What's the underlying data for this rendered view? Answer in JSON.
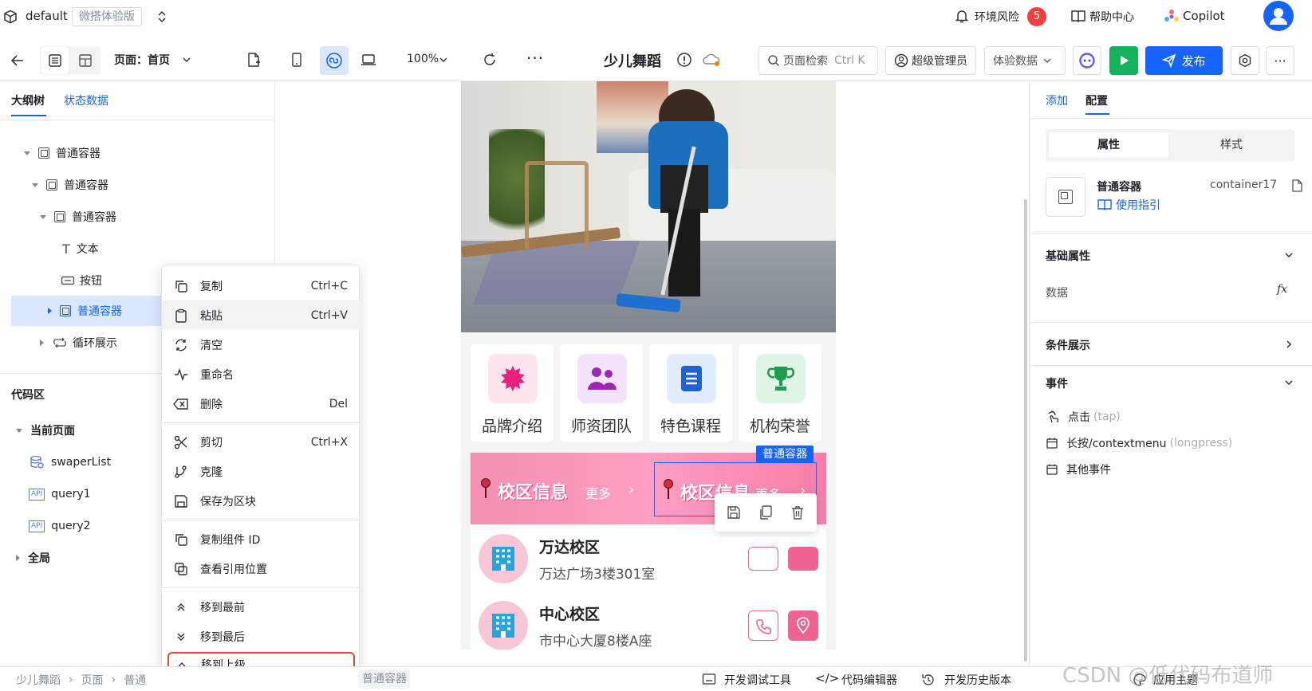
{
  "topbar": {
    "app_name": "default",
    "edition_badge": "微搭体验版",
    "env_risk_label": "环境风险",
    "env_risk_count": "5",
    "help_label": "帮助中心",
    "copilot_label": "Copilot"
  },
  "toolbar": {
    "page_label": "页面：首页",
    "zoom": "100%",
    "app_title": "少儿舞蹈",
    "search_label": "页面检索",
    "search_shortcut": "Ctrl K",
    "admin_label": "超级管理员",
    "data_mode": "体验数据",
    "publish_label": "发布"
  },
  "left": {
    "tab_outline": "大纲树",
    "tab_state": "状态数据",
    "tree": [
      {
        "label": "普通容器"
      },
      {
        "label": "普通容器"
      },
      {
        "label": "普通容器"
      },
      {
        "label": "文本"
      },
      {
        "label": "按钮"
      },
      {
        "label": "普通容器"
      },
      {
        "label": "循环展示"
      }
    ],
    "code_title": "代码区",
    "current_page": "当前页面",
    "code_items": [
      "swaperList",
      "query1",
      "query2"
    ],
    "global_label": "全局",
    "api_tag": "API"
  },
  "menu": {
    "items": [
      {
        "label": "复制",
        "shortcut": "Ctrl+C"
      },
      {
        "label": "粘贴",
        "shortcut": "Ctrl+V"
      },
      {
        "label": "清空",
        "shortcut": ""
      },
      {
        "label": "重命名",
        "shortcut": ""
      },
      {
        "label": "删除",
        "shortcut": "Del"
      },
      {
        "label": "剪切",
        "shortcut": "Ctrl+X"
      },
      {
        "label": "克隆",
        "shortcut": ""
      },
      {
        "label": "保存为区块",
        "shortcut": ""
      },
      {
        "label": "复制组件 ID",
        "shortcut": ""
      },
      {
        "label": "查看引用位置",
        "shortcut": ""
      },
      {
        "label": "移到最前",
        "shortcut": ""
      },
      {
        "label": "移到最后",
        "shortcut": ""
      },
      {
        "label": "移到上级",
        "shortcut": ""
      }
    ]
  },
  "canvas": {
    "cards": [
      {
        "label": "品牌介绍"
      },
      {
        "label": "师资团队"
      },
      {
        "label": "特色课程"
      },
      {
        "label": "机构荣誉"
      }
    ],
    "section_title": "校区信息",
    "more_label": "更多",
    "selected_tag": "普通容器",
    "campuses": [
      {
        "name": "万达校区",
        "address": "万达广场3楼301室"
      },
      {
        "name": "中心校区",
        "address": "市中心大厦8楼A座"
      }
    ]
  },
  "right": {
    "tab_add": "添加",
    "tab_config": "配置",
    "seg_props": "属性",
    "seg_style": "样式",
    "comp_name": "普通容器",
    "comp_id": "container17",
    "guide_label": "使用指引",
    "basic_title": "基础属性",
    "data_label": "数据",
    "fx": "fx",
    "cond_title": "条件展示",
    "event_title": "事件",
    "events": [
      {
        "name": "点击",
        "hint": "(tap)"
      },
      {
        "name": "长按/contextmenu",
        "hint": "(longpress)"
      },
      {
        "name": "其他事件",
        "hint": ""
      }
    ]
  },
  "bottom": {
    "crumbs": [
      "少儿舞蹈",
      "页面",
      "普通",
      "普通容器"
    ],
    "dev_tools": "开发调试工具",
    "code_editor": "代码编辑器",
    "history": "开发历史版本",
    "theme": "应用主题",
    "watermark": "CSDN @低代码布道师"
  },
  "colors": {
    "primary": "#1664ff",
    "green": "#14b25a",
    "pink": "#f06292",
    "badge": "#f53f3f"
  }
}
